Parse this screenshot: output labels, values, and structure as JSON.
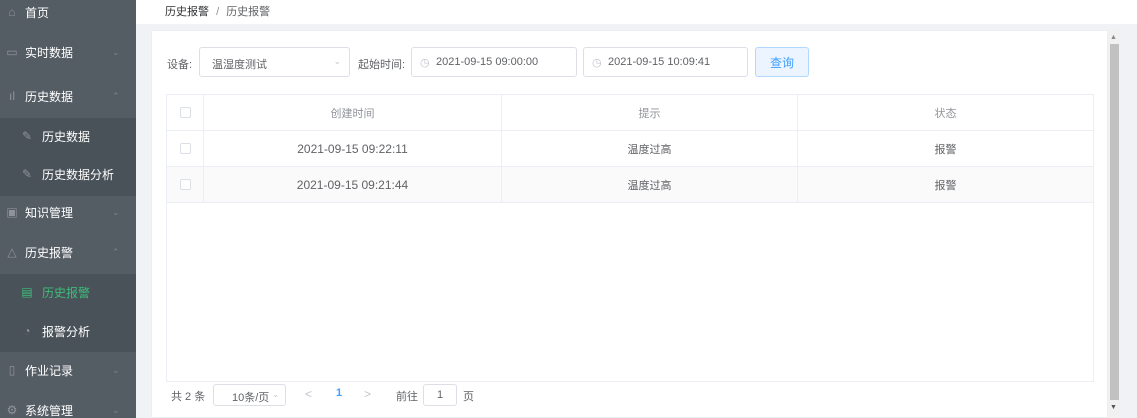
{
  "sidebar": {
    "items": [
      {
        "label": "首页",
        "icon": "home-icon",
        "glyph": "⌂"
      },
      {
        "label": "实时数据",
        "icon": "monitor-icon",
        "glyph": "▭",
        "arrow": "⌄"
      },
      {
        "label": "历史数据",
        "icon": "bar-chart-icon",
        "glyph": "ıl",
        "arrow": "⌃"
      },
      {
        "label": "历史数据",
        "icon": "edit-icon",
        "glyph": "✎"
      },
      {
        "label": "历史数据分析",
        "icon": "edit-icon",
        "glyph": "✎"
      },
      {
        "label": "知识管理",
        "icon": "save-icon",
        "glyph": "▣",
        "arrow": "⌄"
      },
      {
        "label": "历史报警",
        "icon": "bell-icon",
        "glyph": "△",
        "arrow": "⌃"
      },
      {
        "label": "历史报警",
        "icon": "document-icon",
        "glyph": "▤"
      },
      {
        "label": "报警分析",
        "icon": "pie-chart-icon",
        "glyph": "◔"
      },
      {
        "label": "作业记录",
        "icon": "file-icon",
        "glyph": "▯",
        "arrow": "⌄"
      },
      {
        "label": "系统管理",
        "icon": "gear-icon",
        "glyph": "⚙",
        "arrow": "⌄"
      }
    ]
  },
  "breadcrumb": {
    "first": "历史报警",
    "sep": "/",
    "current": "历史报警"
  },
  "filters": {
    "device_label": "设备:",
    "device_value": "温湿度测试",
    "start_label": "起始时间:",
    "start_value": "2021-09-15 09:00:00",
    "end_value": "2021-09-15 10:09:41",
    "query_label": "查询"
  },
  "table": {
    "headers": {
      "time": "创建时间",
      "tip": "提示",
      "status": "状态"
    },
    "rows": [
      {
        "time": "2021-09-15 09:22:11",
        "tip": "温度过高",
        "status": "报警"
      },
      {
        "time": "2021-09-15 09:21:44",
        "tip": "温度过高",
        "status": "报警"
      }
    ]
  },
  "pagination": {
    "total": "共 2 条",
    "page_size": "10条/页",
    "prev": "<",
    "current": "1",
    "next": ">",
    "goto_label": "前往",
    "goto_value": "1",
    "page_suffix": "页"
  },
  "colors": {
    "sidebar": "#545c64",
    "accent": "#409eff",
    "active": "#3dbd7a"
  }
}
